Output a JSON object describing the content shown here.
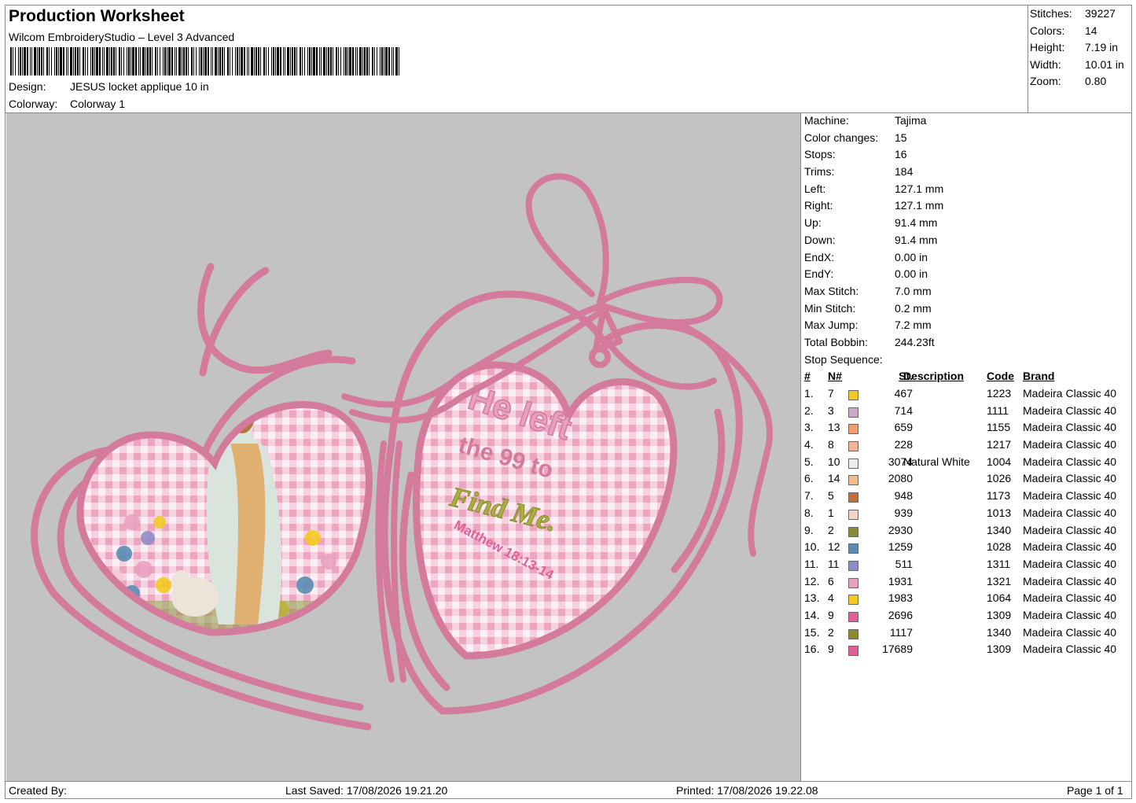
{
  "header": {
    "title": "Production Worksheet",
    "software": "Wilcom EmbroideryStudio – Level 3 Advanced",
    "design_label": "Design:",
    "design_value": "JESUS locket applique 10 in",
    "colorway_label": "Colorway:",
    "colorway_value": "Colorway 1"
  },
  "stats": [
    {
      "label": "Stitches:",
      "value": "39227"
    },
    {
      "label": "Colors:",
      "value": "14"
    },
    {
      "label": "Height:",
      "value": "7.19 in"
    },
    {
      "label": "Width:",
      "value": "10.01 in"
    },
    {
      "label": "Zoom:",
      "value": "0.80"
    }
  ],
  "details": [
    {
      "label": "Machine:",
      "value": "Tajima"
    },
    {
      "label": "Color changes:",
      "value": "15"
    },
    {
      "label": "Stops:",
      "value": "16"
    },
    {
      "label": "Trims:",
      "value": "184"
    },
    {
      "label": "Left:",
      "value": "127.1 mm"
    },
    {
      "label": "Right:",
      "value": "127.1 mm"
    },
    {
      "label": "Up:",
      "value": "91.4 mm"
    },
    {
      "label": "Down:",
      "value": "91.4 mm"
    },
    {
      "label": "EndX:",
      "value": "0.00 in"
    },
    {
      "label": "EndY:",
      "value": "0.00 in"
    },
    {
      "label": "Max Stitch:",
      "value": "7.0 mm"
    },
    {
      "label": "Min Stitch:",
      "value": "0.2 mm"
    },
    {
      "label": "Max Jump:",
      "value": "7.2 mm"
    },
    {
      "label": "Total Bobbin:",
      "value": "244.23ft"
    }
  ],
  "stop_sequence": {
    "title": "Stop Sequence:",
    "columns": {
      "num": "#",
      "n": "N#",
      "st": "St.",
      "desc": "Description",
      "code": "Code",
      "brand": "Brand"
    },
    "rows": [
      {
        "num": "1.",
        "n": "7",
        "color": "#f2c827",
        "st": "467",
        "desc": "",
        "code": "1223",
        "brand": "Madeira Classic 40"
      },
      {
        "num": "2.",
        "n": "3",
        "color": "#c9a8c9",
        "st": "714",
        "desc": "",
        "code": "1111",
        "brand": "Madeira Classic 40"
      },
      {
        "num": "3.",
        "n": "13",
        "color": "#f0a070",
        "st": "659",
        "desc": "",
        "code": "1155",
        "brand": "Madeira Classic 40"
      },
      {
        "num": "4.",
        "n": "8",
        "color": "#f2b49a",
        "st": "228",
        "desc": "",
        "code": "1217",
        "brand": "Madeira Classic 40"
      },
      {
        "num": "5.",
        "n": "10",
        "color": "#ececec",
        "st": "3074",
        "desc": "Natural White",
        "code": "1004",
        "brand": "Madeira Classic 40"
      },
      {
        "num": "6.",
        "n": "14",
        "color": "#f3bc8c",
        "st": "2080",
        "desc": "",
        "code": "1026",
        "brand": "Madeira Classic 40"
      },
      {
        "num": "7.",
        "n": "5",
        "color": "#c0703a",
        "st": "948",
        "desc": "",
        "code": "1173",
        "brand": "Madeira Classic 40"
      },
      {
        "num": "8.",
        "n": "1",
        "color": "#f3d4c8",
        "st": "939",
        "desc": "",
        "code": "1013",
        "brand": "Madeira Classic 40"
      },
      {
        "num": "9.",
        "n": "2",
        "color": "#8a8a30",
        "st": "2930",
        "desc": "",
        "code": "1340",
        "brand": "Madeira Classic 40"
      },
      {
        "num": "10.",
        "n": "12",
        "color": "#5a8cb4",
        "st": "1259",
        "desc": "",
        "code": "1028",
        "brand": "Madeira Classic 40"
      },
      {
        "num": "11.",
        "n": "11",
        "color": "#8c8cc8",
        "st": "511",
        "desc": "",
        "code": "1311",
        "brand": "Madeira Classic 40"
      },
      {
        "num": "12.",
        "n": "6",
        "color": "#e8a0c0",
        "st": "1931",
        "desc": "",
        "code": "1321",
        "brand": "Madeira Classic 40"
      },
      {
        "num": "13.",
        "n": "4",
        "color": "#f5c820",
        "st": "1983",
        "desc": "",
        "code": "1064",
        "brand": "Madeira Classic 40"
      },
      {
        "num": "14.",
        "n": "9",
        "color": "#e06098",
        "st": "2696",
        "desc": "",
        "code": "1309",
        "brand": "Madeira Classic 40"
      },
      {
        "num": "15.",
        "n": "2",
        "color": "#8a8a30",
        "st": "1117",
        "desc": "",
        "code": "1340",
        "brand": "Madeira Classic 40"
      },
      {
        "num": "16.",
        "n": "9",
        "color": "#e06098",
        "st": "17689",
        "desc": "",
        "code": "1309",
        "brand": "Madeira Classic 40"
      }
    ]
  },
  "design_text": {
    "line1": "He left",
    "line2": "the 99 to",
    "line3": "Find Me.",
    "line4": "Matthew 18:13-14"
  },
  "footer": {
    "created_by": "Created By:",
    "last_saved": "Last Saved: 17/08/2026 19.21.20",
    "printed": "Printed: 17/08/2026 19.22.08",
    "page": "Page 1 of 1"
  }
}
